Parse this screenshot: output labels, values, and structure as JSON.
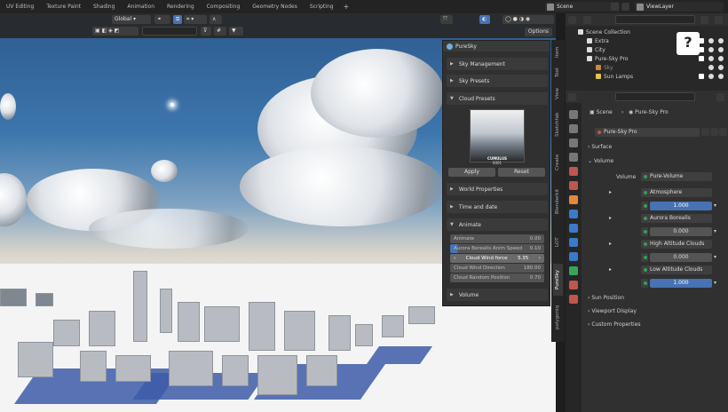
{
  "workspace_tabs": [
    "UV Editing",
    "Texture Paint",
    "Shading",
    "Animation",
    "Rendering",
    "Compositing",
    "Geometry Nodes",
    "Scripting"
  ],
  "scene_name": "Scene",
  "view_layer": "ViewLayer",
  "viewport": {
    "orientation": "Global",
    "options_label": "Options"
  },
  "npanel": {
    "title": "PureSky",
    "sections": {
      "sky_management": "Sky Management",
      "sky_presets": "Sky Presets",
      "cloud_presets": "Cloud Presets",
      "world_properties": "World Properties",
      "time_and_date": "Time and date",
      "animate": "Animate",
      "volume": "Volume"
    },
    "preview_title": "CUMULUS",
    "preview_sub": "0001",
    "apply_label": "Apply",
    "reset_label": "Reset",
    "animate_rows": [
      {
        "label": "Animate",
        "value": "0.00"
      },
      {
        "label": "Aurora Borealis Anim Speed",
        "value": "0.10"
      },
      {
        "label": "Cloud Wind force",
        "value": "5.35"
      },
      {
        "label": "Cloud Wind Direction",
        "value": "180.00"
      },
      {
        "label": "Cloud Random Position",
        "value": "0.70"
      }
    ],
    "side_tabs": [
      "Item",
      "Tool",
      "View",
      "Sketchfab",
      "Create",
      "Blenderkit",
      "LOT",
      "PureSky",
      "polygoniq"
    ]
  },
  "outliner": {
    "rows": [
      {
        "label": "Scene Collection"
      },
      {
        "label": "Extra"
      },
      {
        "label": "City"
      },
      {
        "label": "Pure-Sky Pro"
      },
      {
        "label": "Sky"
      },
      {
        "label": "Sun Lamps"
      }
    ]
  },
  "properties": {
    "breadcrumb_scene": "Scene",
    "breadcrumb_world": "Pure-Sky Pro",
    "world_name": "Pure-Sky Pro",
    "surface": "Surface",
    "volume": "Volume",
    "volume_label": "Volume",
    "volume_value": "Pure-Volume",
    "atmosphere": "Atmosphere",
    "atmosphere_value": "1.000",
    "aurora": "Aurora Borealis",
    "aurora_value": "0.000",
    "high_clouds": "High Altitude Clouds",
    "high_clouds_value": "0.000",
    "low_clouds": "Low Altitude Clouds",
    "low_clouds_value": "1.000",
    "sun_position": "Sun Position",
    "viewport_display": "Viewport Display",
    "custom_properties": "Custom Properties"
  },
  "help_label": "?"
}
